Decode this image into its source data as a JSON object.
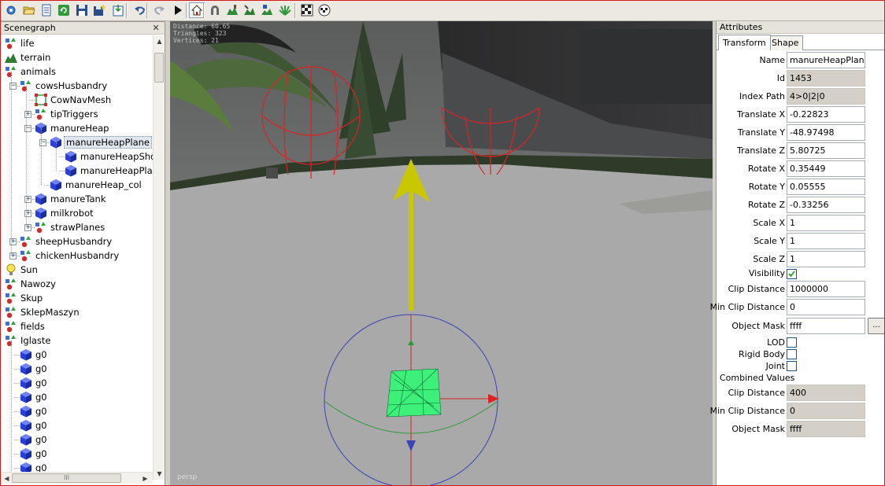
{
  "toolbar": {
    "buttons": [
      {
        "name": "new-scene",
        "icon": "gear-icon"
      },
      {
        "name": "open-file",
        "icon": "folder-open-icon"
      },
      {
        "name": "scene-list",
        "icon": "document-list-icon"
      },
      {
        "name": "refresh",
        "icon": "refresh-icon"
      },
      {
        "name": "save",
        "icon": "floppy-disk-icon"
      },
      {
        "name": "save-as",
        "icon": "floppy-star-icon"
      },
      {
        "name": "import",
        "icon": "import-icon"
      },
      {
        "name": "undo",
        "icon": "undo-icon"
      },
      {
        "name": "redo",
        "icon": "redo-icon"
      },
      {
        "name": "play",
        "icon": "play-icon"
      },
      {
        "name": "select-mode",
        "icon": "house-cursor-icon"
      },
      {
        "name": "magnet-mode",
        "icon": "magnet-icon"
      },
      {
        "name": "terrain-sculpt",
        "icon": "terrain-sculpt-icon"
      },
      {
        "name": "terrain-paint",
        "icon": "terrain-paint-icon"
      },
      {
        "name": "terrain-info",
        "icon": "terrain-info-icon"
      },
      {
        "name": "foliage-paint",
        "icon": "foliage-icon"
      },
      {
        "name": "render-settings",
        "icon": "checker-cog-icon"
      },
      {
        "name": "material-settings",
        "icon": "checker-sphere-icon"
      }
    ]
  },
  "scenegraph": {
    "title": "Scenegraph",
    "close": "✕",
    "nodes": [
      {
        "label": "life",
        "depth": 0,
        "icon": "transform-group-icon",
        "expander": ""
      },
      {
        "label": "terrain",
        "depth": 0,
        "icon": "terrain-icon",
        "expander": ""
      },
      {
        "label": "animals",
        "depth": 0,
        "icon": "transform-group-icon",
        "expander": ""
      },
      {
        "label": "cowsHusbandry",
        "depth": 1,
        "icon": "transform-group-icon",
        "expander": "−"
      },
      {
        "label": "CowNavMesh",
        "depth": 2,
        "icon": "navmesh-icon",
        "expander": ""
      },
      {
        "label": "tipTriggers",
        "depth": 2,
        "icon": "transform-group-icon",
        "expander": "+"
      },
      {
        "label": "manureHeap",
        "depth": 2,
        "icon": "cube-icon",
        "expander": "−"
      },
      {
        "label": "manureHeapPlane",
        "depth": 3,
        "icon": "cube-icon",
        "expander": "−",
        "selected": true
      },
      {
        "label": "manureHeapShovel",
        "depth": 4,
        "icon": "cube-icon",
        "expander": ""
      },
      {
        "label": "manureHeapPlane",
        "depth": 4,
        "icon": "cube-icon",
        "expander": ""
      },
      {
        "label": "manureHeap_col",
        "depth": 3,
        "icon": "cube-icon",
        "expander": ""
      },
      {
        "label": "manureTank",
        "depth": 2,
        "icon": "cube-icon",
        "expander": "+"
      },
      {
        "label": "milkrobot",
        "depth": 2,
        "icon": "cube-icon",
        "expander": "+"
      },
      {
        "label": "strawPlanes",
        "depth": 2,
        "icon": "transform-group-icon",
        "expander": "+"
      },
      {
        "label": "sheepHusbandry",
        "depth": 1,
        "icon": "transform-group-icon",
        "expander": "+"
      },
      {
        "label": "chickenHusbandry",
        "depth": 1,
        "icon": "transform-group-icon",
        "expander": "+"
      },
      {
        "label": "Sun",
        "depth": 0,
        "icon": "light-bulb-icon",
        "expander": ""
      },
      {
        "label": "Nawozy",
        "depth": 0,
        "icon": "transform-group-icon",
        "expander": ""
      },
      {
        "label": "Skup",
        "depth": 0,
        "icon": "transform-group-icon",
        "expander": ""
      },
      {
        "label": "SklepMaszyn",
        "depth": 0,
        "icon": "transform-group-icon",
        "expander": ""
      },
      {
        "label": "fields",
        "depth": 0,
        "icon": "transform-group-icon",
        "expander": ""
      },
      {
        "label": "Iglaste",
        "depth": 0,
        "icon": "transform-group-icon",
        "expander": ""
      },
      {
        "label": "g0",
        "depth": 1,
        "icon": "cube-icon",
        "expander": ""
      },
      {
        "label": "g0",
        "depth": 1,
        "icon": "cube-icon",
        "expander": ""
      },
      {
        "label": "g0",
        "depth": 1,
        "icon": "cube-icon",
        "expander": ""
      },
      {
        "label": "g0",
        "depth": 1,
        "icon": "cube-icon",
        "expander": ""
      },
      {
        "label": "g0",
        "depth": 1,
        "icon": "cube-icon",
        "expander": ""
      },
      {
        "label": "g0",
        "depth": 1,
        "icon": "cube-icon",
        "expander": ""
      },
      {
        "label": "g0",
        "depth": 1,
        "icon": "cube-icon",
        "expander": ""
      },
      {
        "label": "g0",
        "depth": 1,
        "icon": "cube-icon",
        "expander": ""
      },
      {
        "label": "g0",
        "depth": 1,
        "icon": "cube-icon",
        "expander": ""
      }
    ],
    "hscroll_grip": "III"
  },
  "viewport": {
    "hud_lines": [
      "Distance: 60.65",
      "Triangles: 323",
      "Vertices: 21"
    ],
    "camera_label": "persp"
  },
  "attributes": {
    "title": "Attributes",
    "tabs": [
      "Transform",
      "Shape"
    ],
    "active_tab": "Transform",
    "fields": [
      {
        "label": "Name",
        "value": "manureHeapPlane",
        "readonly": false
      },
      {
        "label": "Id",
        "value": "1453",
        "readonly": true
      },
      {
        "label": "Index Path",
        "value": "4>0|2|0",
        "readonly": true
      },
      {
        "label": "Translate X",
        "value": "-0.22823",
        "readonly": false
      },
      {
        "label": "Translate Y",
        "value": "-48.97498",
        "readonly": false
      },
      {
        "label": "Translate Z",
        "value": "5.80725",
        "readonly": false
      },
      {
        "label": "Rotate X",
        "value": "0.35449",
        "readonly": false
      },
      {
        "label": "Rotate Y",
        "value": "0.05555",
        "readonly": false
      },
      {
        "label": "Rotate Z",
        "value": "-0.33256",
        "readonly": false
      },
      {
        "label": "Scale X",
        "value": "1",
        "readonly": false
      },
      {
        "label": "Scale Y",
        "value": "1",
        "readonly": false
      },
      {
        "label": "Scale Z",
        "value": "1",
        "readonly": false
      }
    ],
    "visibility": {
      "label": "Visibility",
      "checked": true
    },
    "clip_distance": {
      "label": "Clip Distance",
      "value": "1000000"
    },
    "min_clip_distance": {
      "label": "Min Clip Distance",
      "value": "0"
    },
    "object_mask": {
      "label": "Object Mask",
      "value": "ffff",
      "button": "..."
    },
    "lod": {
      "label": "LOD",
      "checked": false
    },
    "rigid_body": {
      "label": "Rigid Body",
      "checked": false
    },
    "joint": {
      "label": "Joint",
      "checked": false
    },
    "combined": {
      "title": "Combined Values",
      "clip_distance": {
        "label": "Clip Distance",
        "value": "400"
      },
      "min_clip_distance": {
        "label": "Min Clip Distance",
        "value": "0"
      },
      "object_mask": {
        "label": "Object Mask",
        "value": "ffff"
      }
    }
  },
  "colors": {
    "selection_highlight": "#e1e6ef",
    "gizmo_arrow": "#c8c800",
    "mesh_wireframe": "#3cf07a",
    "cube_icon": "#2a3fd6"
  }
}
